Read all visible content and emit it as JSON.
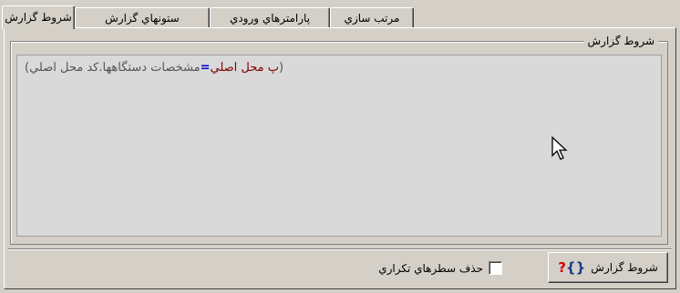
{
  "tabs": [
    {
      "label": "شروط گزارش",
      "active": true
    },
    {
      "label": "ستونهاي گزارش",
      "active": false
    },
    {
      "label": "پارامترهاي ورودي",
      "active": false
    },
    {
      "label": "مرتب سازي",
      "active": false
    }
  ],
  "conditions_group": {
    "title": "شروط گزارش",
    "expression": {
      "open_paren": "(",
      "field": "پ محل اصلي",
      "operator": "=",
      "table_field": "مشخصات دستگاهها.کد محل اصلي",
      "close_paren": ")"
    }
  },
  "bottom": {
    "dedup_label": "حذف سطرهاي تکراري",
    "dedup_checked": false,
    "conditions_button_label": "شروط گزارش",
    "conditions_button_icon": "brace-question-icon"
  },
  "colors": {
    "field": "#800000",
    "operator": "#0000cc",
    "icon_question": "#d00000"
  }
}
